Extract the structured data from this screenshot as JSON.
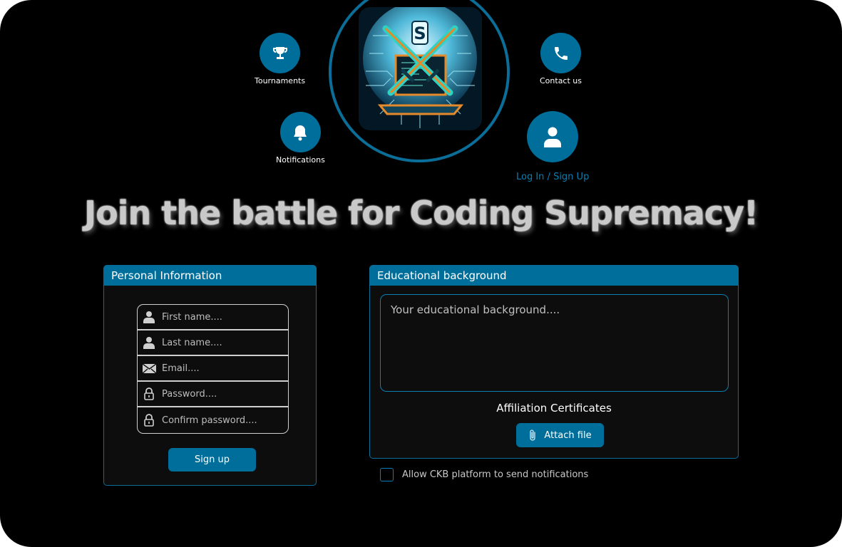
{
  "nav": {
    "tournaments": "Tournaments",
    "notifications": "Notifications",
    "contact": "Contact us",
    "login": "Log In / Sign Up"
  },
  "headline": "Join the battle for Coding Supremacy!",
  "personal": {
    "title": "Personal Information",
    "fields": [
      {
        "placeholder": "First name....",
        "icon": "user-icon"
      },
      {
        "placeholder": "Last name....",
        "icon": "user-icon"
      },
      {
        "placeholder": "Email....",
        "icon": "envelope-icon"
      },
      {
        "placeholder": "Password....",
        "icon": "lock-icon"
      },
      {
        "placeholder": "Confirm password....",
        "icon": "lock-icon"
      }
    ],
    "signup_label": "Sign up"
  },
  "education": {
    "title": "Educational background",
    "placeholder": "Your educational background....",
    "cert_label": "Affiliation Certificates",
    "attach_label": "Attach file"
  },
  "consent": {
    "label": "Allow CKB platform to send notifications"
  },
  "colors": {
    "accent": "#006e9a",
    "background": "#000000",
    "panel": "#0d0d0d"
  }
}
